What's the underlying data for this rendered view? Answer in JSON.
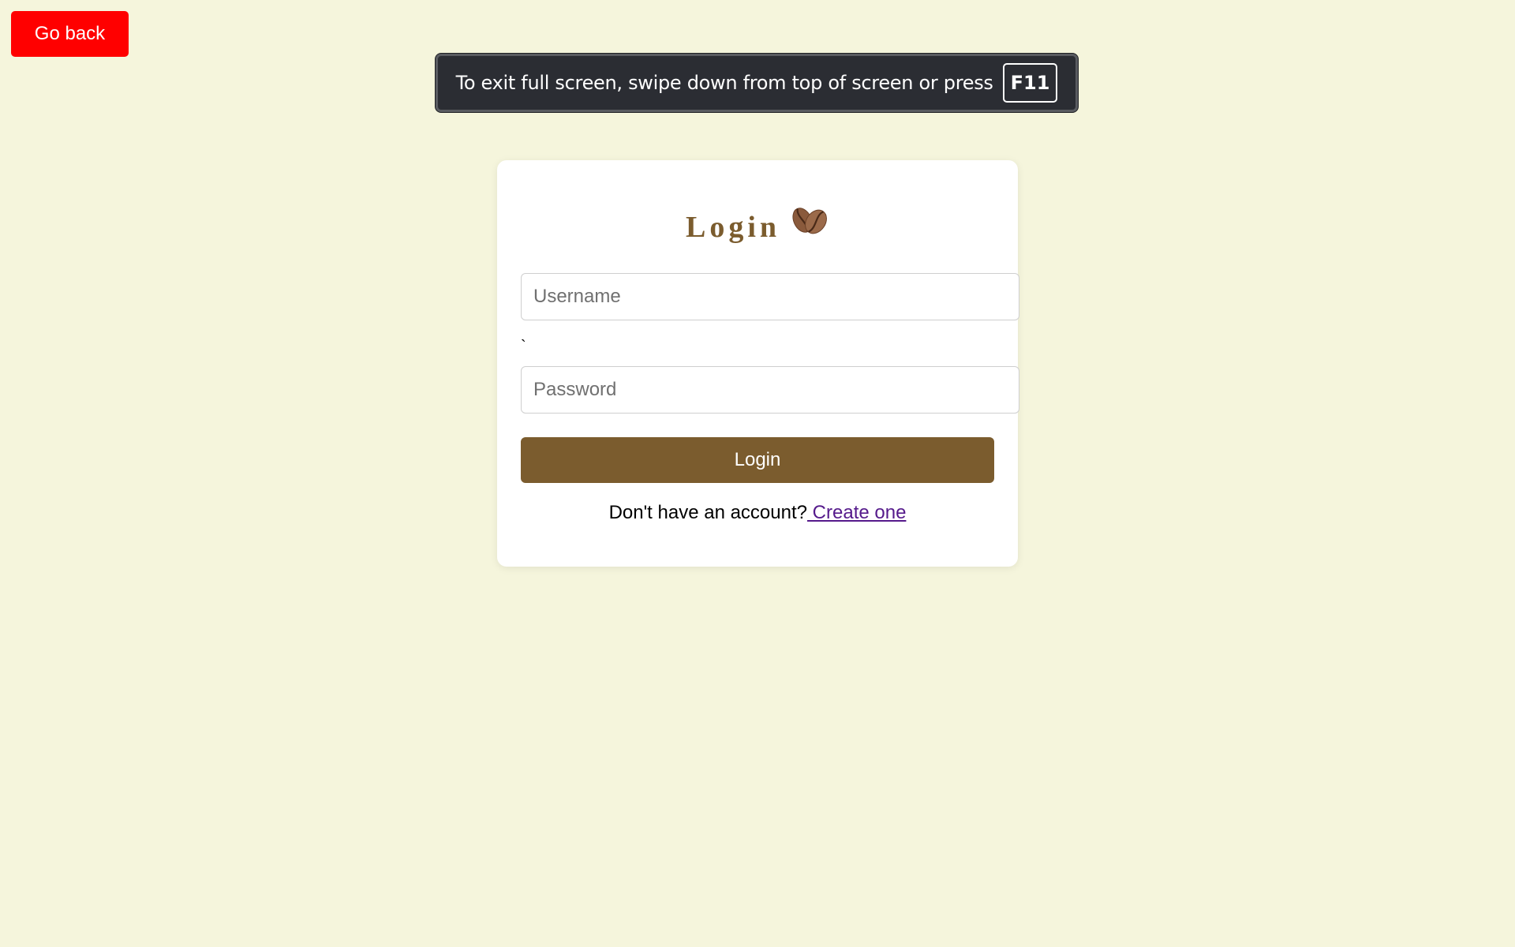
{
  "go_back": {
    "label": "Go back"
  },
  "fullscreen_banner": {
    "message": "To exit full screen, swipe down from top of screen or press",
    "key": "F11"
  },
  "login_card": {
    "title": "Login",
    "title_icon": "coffee-bean-icon",
    "username": {
      "placeholder": "Username",
      "value": ""
    },
    "stray_text": "`",
    "password": {
      "placeholder": "Password",
      "value": ""
    },
    "submit_label": "Login",
    "signup_prompt": "Don't have an account?",
    "signup_link": " Create one"
  },
  "colors": {
    "background": "#f5f5dc",
    "go_back": "#ff0000",
    "accent": "#7b5c2e",
    "link": "#551a8b",
    "banner": "#2b2d33"
  }
}
